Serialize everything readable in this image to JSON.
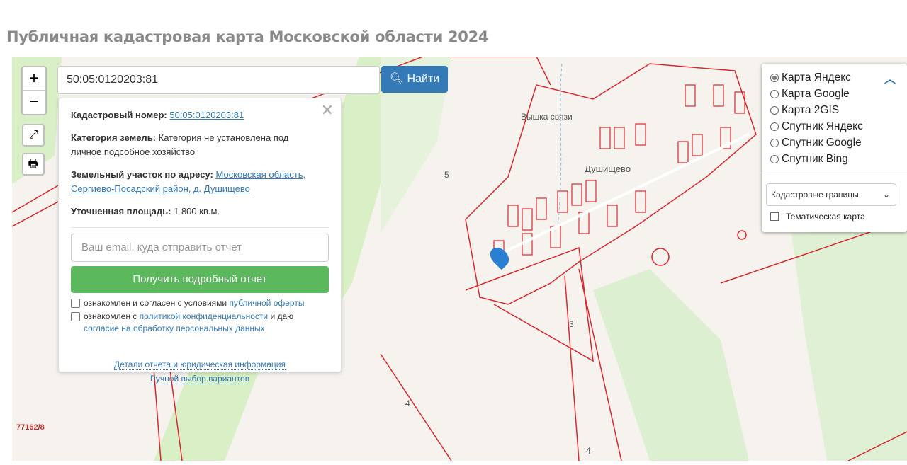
{
  "page": {
    "title": "Публичная кадастровая карта Московской области 2024"
  },
  "controls": {
    "zoom_in": "+",
    "zoom_out": "−",
    "fullscreen_icon": "expand-icon",
    "print_icon": "printer-icon"
  },
  "search": {
    "value": "50:05:0120203:81",
    "button": "Найти",
    "icon": "search-icon"
  },
  "popup": {
    "cad_label": "Кадастровый номер:",
    "cad_value": "50:05:0120203:81",
    "cat_label": "Категория земель:",
    "cat_value": "Категория не установлена под личное подсобное хозяйство",
    "addr_label": "Земельный участок по адресу:",
    "addr_value": "Московская область, Сергиево-Посадский район, д. Душищево",
    "area_label": "Уточненная площадь:",
    "area_value": "1 800 кв.м.",
    "email_placeholder": "Ваш email, куда отправить отчет",
    "get_report": "Получить подробный отчет",
    "check1_text": "ознакомлен и согласен с условиями ",
    "check1_link": "публичной оферты",
    "check2_text": "ознакомлен с ",
    "check2_link": "политикой конфиденциальности",
    "check2_mid": " и даю ",
    "check2_link2": "согласие на обработку персональных данных",
    "details_link": "Детали отчета и юридическая информация",
    "manual_link": "Ручной выбор вариантов"
  },
  "layers": {
    "options": [
      {
        "label": "Карта Яндекс",
        "selected": true
      },
      {
        "label": "Карта Google"
      },
      {
        "label": "Карта 2GIS"
      },
      {
        "label": "Спутник Яндекс"
      },
      {
        "label": "Спутник Google"
      },
      {
        "label": "Спутник Bing"
      }
    ],
    "overlay_select": "Кадастровые границы",
    "thematic": "Тематическая карта"
  },
  "map_labels": {
    "tower": "Вышка связи",
    "village": "Душищево",
    "n5": "5",
    "n3": "3",
    "n4a": "4",
    "n4b": "4",
    "parcel": "77162/8"
  },
  "colors": {
    "parcel_border": "#d9272e",
    "primary": "#337ab7",
    "success": "#5cb85c"
  }
}
